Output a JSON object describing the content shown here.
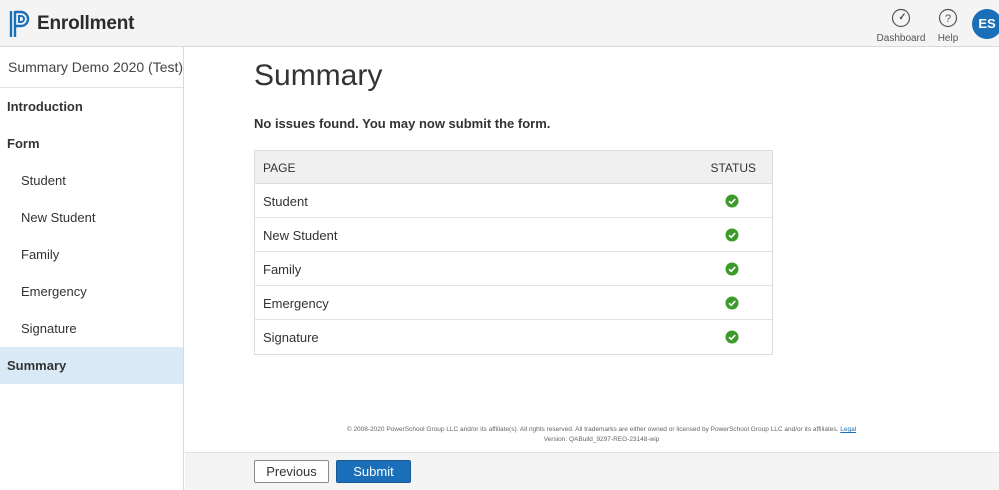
{
  "header": {
    "app_title": "Enrollment",
    "dashboard_label": "Dashboard",
    "help_label": "Help",
    "avatar_initials": "ES",
    "accent_color": "#1b6fb8"
  },
  "sidebar": {
    "form_title": "Summary Demo 2020 (Test)",
    "items": [
      {
        "label": "Introduction",
        "level": "top"
      },
      {
        "label": "Form",
        "level": "top"
      },
      {
        "label": "Student",
        "level": "sub"
      },
      {
        "label": "New Student",
        "level": "sub"
      },
      {
        "label": "Family",
        "level": "sub"
      },
      {
        "label": "Emergency",
        "level": "sub"
      },
      {
        "label": "Signature",
        "level": "sub"
      },
      {
        "label": "Summary",
        "level": "top",
        "active": true
      }
    ]
  },
  "main": {
    "title": "Summary",
    "message": "No issues found. You may now submit the form.",
    "table": {
      "headers": {
        "page": "PAGE",
        "status": "STATUS"
      },
      "rows": [
        {
          "page": "Student",
          "status_icon": "check-circle-icon"
        },
        {
          "page": "New Student",
          "status_icon": "check-circle-icon"
        },
        {
          "page": "Family",
          "status_icon": "check-circle-icon"
        },
        {
          "page": "Emergency",
          "status_icon": "check-circle-icon"
        },
        {
          "page": "Signature",
          "status_icon": "check-circle-icon"
        }
      ]
    },
    "status_color": "#3a9b2a"
  },
  "footer": {
    "copyright": "© 2008-2020 PowerSchool Group LLC and/or its affiliate(s). All rights reserved. All trademarks are either owned or licensed by PowerSchool Group LLC and/or its affiliates.",
    "legal_link": "Legal",
    "version": "Version: QABuild_9297-REG-23148-wip"
  },
  "actions": {
    "previous_label": "Previous",
    "submit_label": "Submit"
  }
}
